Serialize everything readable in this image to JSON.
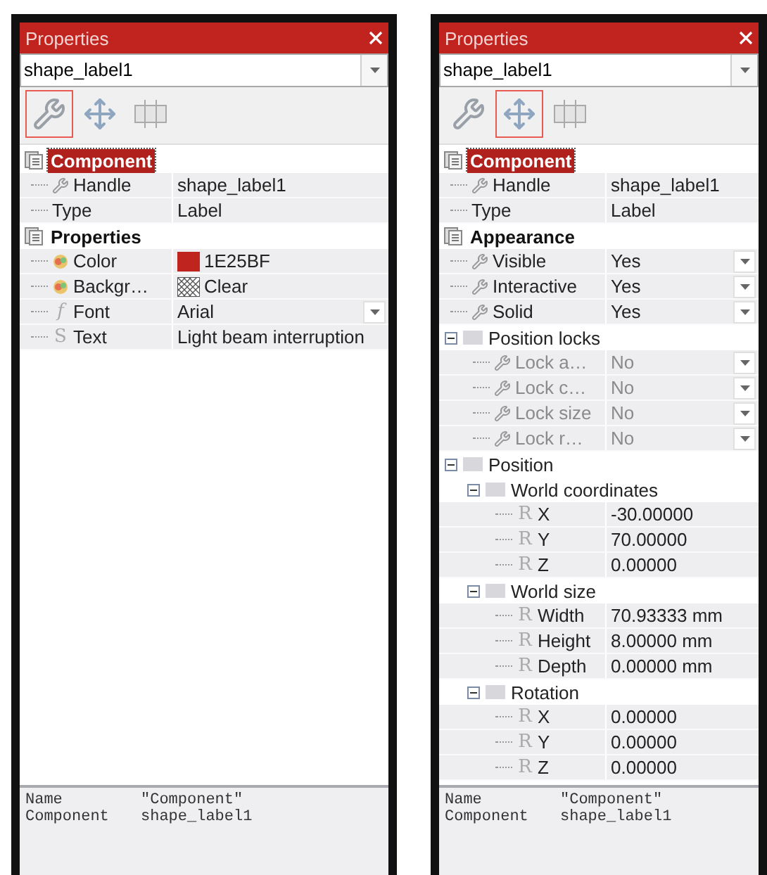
{
  "panels": [
    {
      "title": "Properties",
      "object_selector": {
        "value": "shape_label1"
      },
      "tools": [
        {
          "kind": "wrench",
          "selected": true
        },
        {
          "kind": "move",
          "selected": false
        },
        {
          "kind": "frame",
          "selected": false
        }
      ],
      "tree": [
        {
          "kind": "category",
          "label": "Component",
          "selected": true,
          "children": [
            {
              "kind": "setting",
              "label": "Handle",
              "value": "shape_label1"
            },
            {
              "kind": "plain",
              "label": "Type",
              "value": "Label"
            }
          ]
        },
        {
          "kind": "category",
          "label": "Properties",
          "selected": false,
          "children": [
            {
              "kind": "color",
              "label": "Color",
              "value": "1E25BF",
              "color": "#bf251e"
            },
            {
              "kind": "fill",
              "label": "Backgr…",
              "value": "Clear"
            },
            {
              "kind": "font",
              "glyph": "f",
              "label": "Font",
              "value": "Arial",
              "dropdown": true
            },
            {
              "kind": "text",
              "glyph": "S",
              "label": "Text",
              "value": "Light beam interruption"
            }
          ]
        }
      ],
      "info": [
        [
          "Name",
          "\"Component\""
        ],
        [
          "Component",
          "shape_label1"
        ]
      ]
    },
    {
      "title": "Properties",
      "object_selector": {
        "value": "shape_label1"
      },
      "tools": [
        {
          "kind": "wrench",
          "selected": false
        },
        {
          "kind": "move",
          "selected": true
        },
        {
          "kind": "frame",
          "selected": false
        }
      ],
      "tree": [
        {
          "kind": "category",
          "label": "Component",
          "selected": true,
          "children": [
            {
              "kind": "setting",
              "label": "Handle",
              "value": "shape_label1"
            },
            {
              "kind": "plain",
              "label": "Type",
              "value": "Label"
            }
          ]
        },
        {
          "kind": "category",
          "label": "Appearance",
          "selected": false,
          "children": [
            {
              "kind": "setting",
              "label": "Visible",
              "value": "Yes",
              "dropdown": true
            },
            {
              "kind": "setting",
              "label": "Interactive",
              "value": "Yes",
              "dropdown": true
            },
            {
              "kind": "setting",
              "label": "Solid",
              "value": "Yes",
              "dropdown": true
            },
            {
              "kind": "group",
              "label": "Position locks",
              "expanded": true,
              "children": [
                {
                  "kind": "setting",
                  "label": "Lock a…",
                  "value": "No",
                  "dropdown": true,
                  "disabled": true
                },
                {
                  "kind": "setting",
                  "label": "Lock c…",
                  "value": "No",
                  "dropdown": true,
                  "disabled": true
                },
                {
                  "kind": "setting",
                  "label": "Lock size",
                  "value": "No",
                  "dropdown": true,
                  "disabled": true
                },
                {
                  "kind": "setting",
                  "label": "Lock r…",
                  "value": "No",
                  "dropdown": true,
                  "disabled": true
                }
              ]
            },
            {
              "kind": "group",
              "label": "Position",
              "expanded": true,
              "children": [
                {
                  "kind": "group",
                  "label": "World coordinates",
                  "expanded": true,
                  "children": [
                    {
                      "kind": "number",
                      "glyph": "R",
                      "label": "X",
                      "value": "-30.00000"
                    },
                    {
                      "kind": "number",
                      "glyph": "R",
                      "label": "Y",
                      "value": "70.00000"
                    },
                    {
                      "kind": "number",
                      "glyph": "R",
                      "label": "Z",
                      "value": "0.00000"
                    }
                  ]
                },
                {
                  "kind": "group",
                  "label": "World size",
                  "expanded": true,
                  "children": [
                    {
                      "kind": "number",
                      "glyph": "R",
                      "label": "Width",
                      "value": "70.93333 mm"
                    },
                    {
                      "kind": "number",
                      "glyph": "R",
                      "label": "Height",
                      "value": "8.00000 mm"
                    },
                    {
                      "kind": "number",
                      "glyph": "R",
                      "label": "Depth",
                      "value": "0.00000 mm"
                    }
                  ]
                },
                {
                  "kind": "group",
                  "label": "Rotation",
                  "expanded": true,
                  "children": [
                    {
                      "kind": "number",
                      "glyph": "R",
                      "label": "X",
                      "value": "0.00000"
                    },
                    {
                      "kind": "number",
                      "glyph": "R",
                      "label": "Y",
                      "value": "0.00000"
                    },
                    {
                      "kind": "number",
                      "glyph": "R",
                      "label": "Z",
                      "value": "0.00000"
                    }
                  ]
                }
              ]
            }
          ]
        }
      ],
      "info": [
        [
          "Name",
          "\"Component\""
        ],
        [
          "Component",
          "shape_label1"
        ]
      ]
    }
  ]
}
